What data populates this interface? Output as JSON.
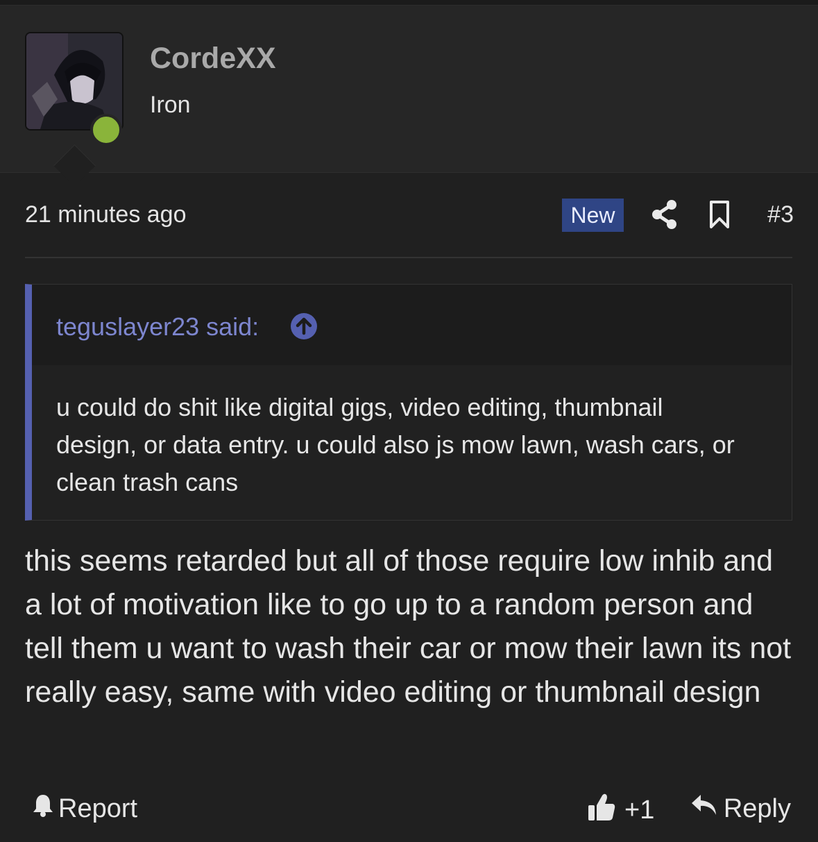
{
  "user": {
    "name": "CordeXX",
    "title": "Iron",
    "avatar_icon": "avatar-image",
    "status_color": "#8ab43a"
  },
  "meta": {
    "timestamp": "21 minutes ago",
    "badge": "New",
    "post_number": "#3"
  },
  "quote": {
    "author": "teguslayer23 said:",
    "text": "u could do shit like digital gigs, video editing, thumbnail design, or data entry. u could also js mow lawn, wash cars, or clean trash cans",
    "accent_color": "#5560b0"
  },
  "post": {
    "body": "this seems retarded but all of those require low inhib and a lot of motivation like to go up to a random person and tell them u want to wash their car or mow their lawn its not really easy, same with video editing or thumbnail design"
  },
  "actions": {
    "report": "Report",
    "like_count": "+1",
    "reply": "Reply"
  }
}
